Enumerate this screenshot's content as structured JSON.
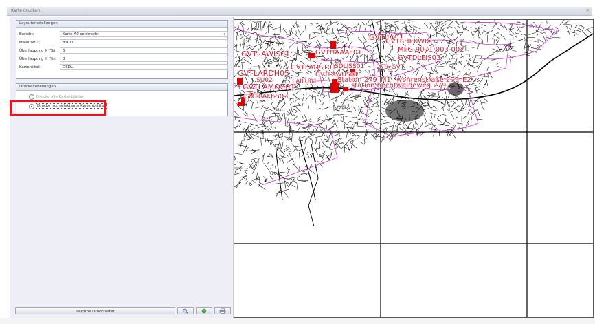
{
  "window": {
    "title": "Karte drucken",
    "close_glyph": "×"
  },
  "layout_group": {
    "title": "Layouteinstellungen",
    "fields": [
      {
        "label": "Bericht:",
        "value": "Karte A0 senkrecht"
      },
      {
        "label": "Maßstab 1:",
        "value": "8'800"
      },
      {
        "label": "Überlappung X (%):",
        "value": "0"
      },
      {
        "label": "Überlappung Y (%):",
        "value": "0"
      },
      {
        "label": "Kartentitel:",
        "value": "DSDL"
      }
    ]
  },
  "print_group": {
    "title": "Druckeinstellungen",
    "options": [
      {
        "label": "Drucke alle Kartenblätter",
        "selected": false
      },
      {
        "label": "Drucke nur selektierte Kartenblätter",
        "selected": true
      }
    ]
  },
  "buttons": {
    "draw_grid": "Zeichne Druckraster",
    "zoom_icon": "magnifier-icon",
    "refresh_icon": "refresh-icon",
    "print_icon": "printer-icon"
  },
  "map": {
    "labels": [
      "GVTIIA01",
      "GVTSHEKW01",
      "GVTLAWIS01",
      "GVTHAAAF01",
      "MFG-9071-003-002",
      "GVTDLEIS03",
      "GVTLARDH05",
      "GVTLADST01",
      "GVTLAWUS01",
      "SDLJSS01",
      "279_GVT",
      "SU02",
      "LAILU01",
      "Station 279_M1",
      "wohrenstraße 279_E2",
      "GVTLAMOZ01",
      "station hechtweideweg 279_",
      "GVTLAFES03"
    ],
    "colors": {
      "grid": "#000000",
      "labels": "#c8243a",
      "boundaries": "#cc33cc",
      "selected": "#e00000"
    }
  }
}
